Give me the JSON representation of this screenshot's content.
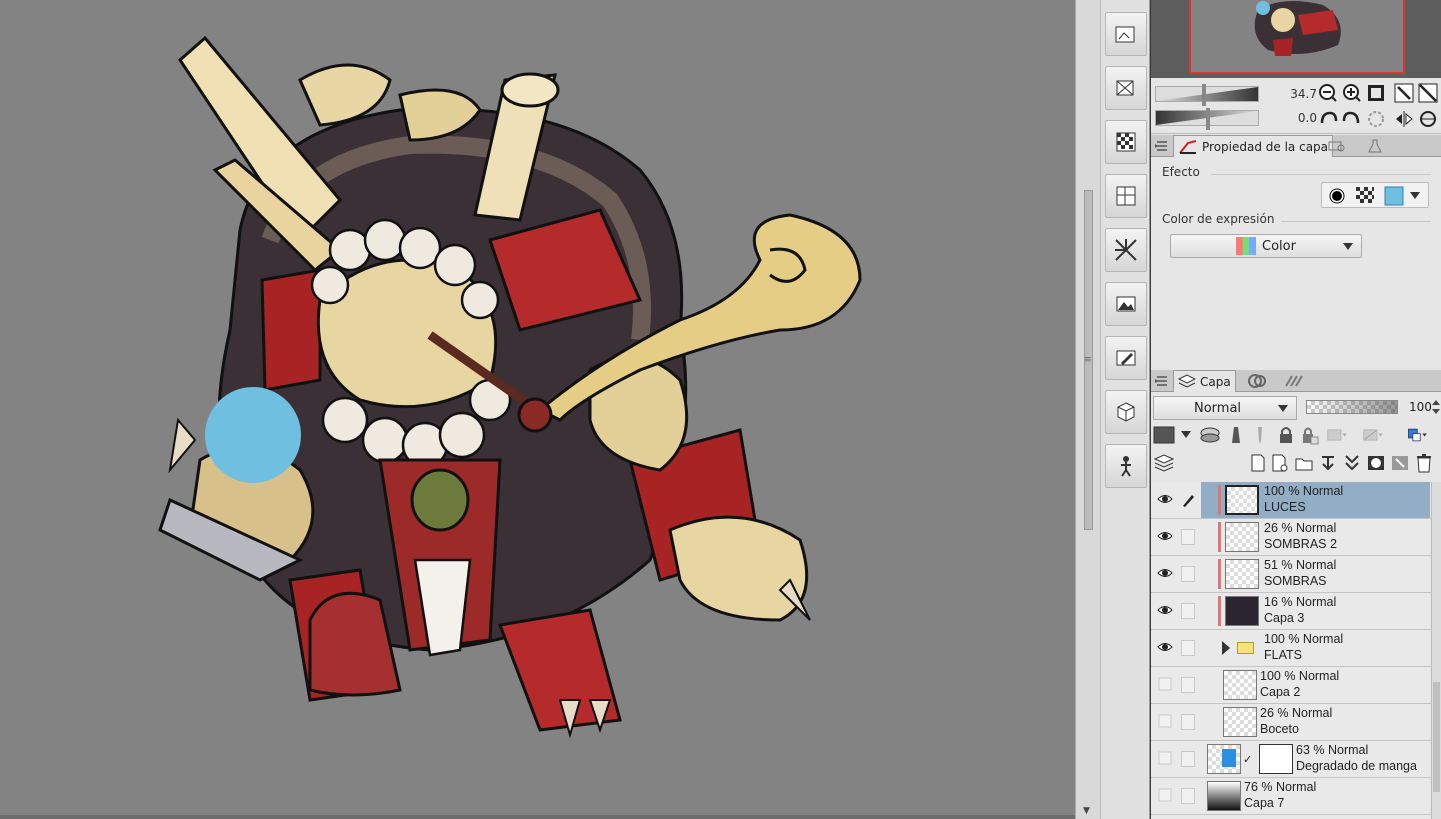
{
  "navigator": {
    "zoom_value": "34.7",
    "rotation_value": "0.0"
  },
  "property_panel": {
    "tab_label": "Propiedad de la capa",
    "effect_title": "Efecto",
    "expression_color_title": "Color de expresión",
    "expression_color_value": "Color"
  },
  "layer_panel": {
    "tab_label": "Capa",
    "blend_mode": "Normal",
    "opacity": "100",
    "layers": [
      {
        "opacity_mode": "100 % Normal",
        "name": "LUCES",
        "visible": true,
        "selected": true,
        "clipped": true,
        "thumb": "checker"
      },
      {
        "opacity_mode": "26 % Normal",
        "name": "SOMBRAS 2",
        "visible": true,
        "selected": false,
        "clipped": true,
        "thumb": "checker"
      },
      {
        "opacity_mode": "51 % Normal",
        "name": "SOMBRAS",
        "visible": true,
        "selected": false,
        "clipped": true,
        "thumb": "checker"
      },
      {
        "opacity_mode": "16 % Normal",
        "name": "Capa 3",
        "visible": true,
        "selected": false,
        "clipped": true,
        "thumb": "dark"
      },
      {
        "opacity_mode": "100 % Normal",
        "name": "FLATS",
        "visible": true,
        "selected": false,
        "clipped": false,
        "thumb": "folder"
      },
      {
        "opacity_mode": "100 % Normal",
        "name": "Capa 2",
        "visible": false,
        "selected": false,
        "clipped": false,
        "thumb": "checker"
      },
      {
        "opacity_mode": "26 % Normal",
        "name": "Boceto",
        "visible": false,
        "selected": false,
        "clipped": false,
        "thumb": "checker"
      },
      {
        "opacity_mode": "63 % Normal",
        "name": "Degradado de manga",
        "visible": false,
        "selected": false,
        "clipped": false,
        "thumb": "gradient-mask"
      },
      {
        "opacity_mode": "76 % Normal",
        "name": "Capa 7",
        "visible": false,
        "selected": false,
        "clipped": false,
        "thumb": "gradient"
      }
    ]
  },
  "colors": {
    "canvas_bg": "#838383",
    "selected_layer": "#93adc4",
    "clip_marker": "#dd7777",
    "accent_blue_circle": "#6fbfe0"
  }
}
